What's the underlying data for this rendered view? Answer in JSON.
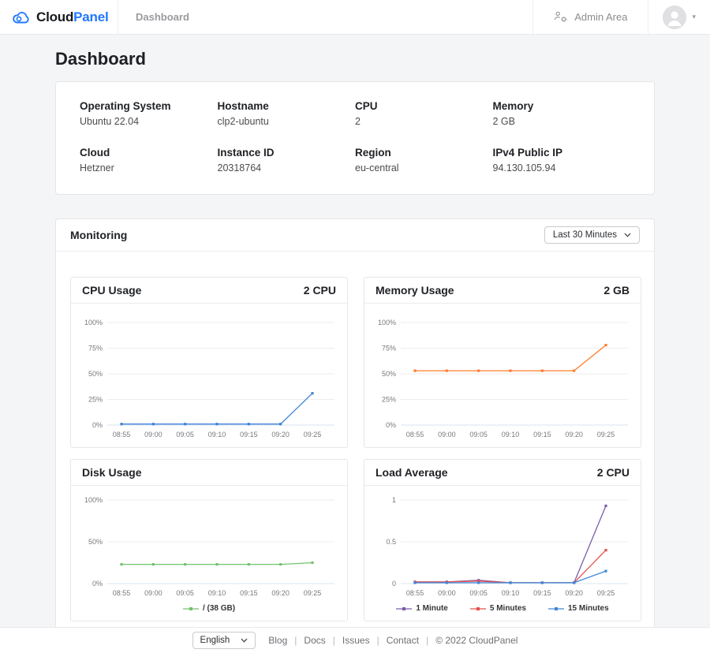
{
  "navbar": {
    "brand_primary": "Cloud",
    "brand_secondary": "Panel",
    "breadcrumb": "Dashboard",
    "admin_area_label": "Admin Area"
  },
  "page": {
    "title": "Dashboard"
  },
  "system_info": {
    "fields": [
      {
        "label": "Operating System",
        "value": "Ubuntu 22.04"
      },
      {
        "label": "Hostname",
        "value": "clp2-ubuntu"
      },
      {
        "label": "CPU",
        "value": "2"
      },
      {
        "label": "Memory",
        "value": "2 GB"
      },
      {
        "label": "Cloud",
        "value": "Hetzner"
      },
      {
        "label": "Instance ID",
        "value": "20318764"
      },
      {
        "label": "Region",
        "value": "eu-central"
      },
      {
        "label": "IPv4 Public IP",
        "value": "94.130.105.94"
      }
    ]
  },
  "monitoring": {
    "title": "Monitoring",
    "range_selected": "Last 30 Minutes"
  },
  "chart_data": [
    {
      "type": "line",
      "title": "CPU Usage",
      "annotation": "2 CPU",
      "x": [
        "08:55",
        "09:00",
        "09:05",
        "09:10",
        "09:15",
        "09:20",
        "09:25"
      ],
      "ylim": [
        0,
        100
      ],
      "yticks": [
        {
          "v": 0,
          "label": "0%"
        },
        {
          "v": 25,
          "label": "25%"
        },
        {
          "v": 50,
          "label": "50%"
        },
        {
          "v": 75,
          "label": "75%"
        },
        {
          "v": 100,
          "label": "100%"
        }
      ],
      "show_legend": false,
      "series": [
        {
          "name": "CPU Usage",
          "color": "#3f83d8",
          "values": [
            1,
            1,
            1,
            1,
            1,
            1,
            31
          ]
        }
      ]
    },
    {
      "type": "line",
      "title": "Memory Usage",
      "annotation": "2 GB",
      "x": [
        "08:55",
        "09:00",
        "09:05",
        "09:10",
        "09:15",
        "09:20",
        "09:25"
      ],
      "ylim": [
        0,
        100
      ],
      "yticks": [
        {
          "v": 0,
          "label": "0%"
        },
        {
          "v": 25,
          "label": "25%"
        },
        {
          "v": 50,
          "label": "50%"
        },
        {
          "v": 75,
          "label": "75%"
        },
        {
          "v": 100,
          "label": "100%"
        }
      ],
      "show_legend": false,
      "series": [
        {
          "name": "Memory Usage",
          "color": "#ff7d2a",
          "values": [
            53,
            53,
            53,
            53,
            53,
            53,
            78
          ]
        }
      ]
    },
    {
      "type": "line",
      "title": "Disk Usage",
      "annotation": "",
      "x": [
        "08:55",
        "09:00",
        "09:05",
        "09:10",
        "09:15",
        "09:20",
        "09:25"
      ],
      "ylim": [
        0,
        100
      ],
      "yticks": [
        {
          "v": 0,
          "label": "0%"
        },
        {
          "v": 50,
          "label": "50%"
        },
        {
          "v": 100,
          "label": "100%"
        }
      ],
      "show_legend": true,
      "series": [
        {
          "name": "/ (38 GB)",
          "color": "#74c26d",
          "values": [
            23,
            23,
            23,
            23,
            23,
            23,
            25
          ]
        }
      ]
    },
    {
      "type": "line",
      "title": "Load Average",
      "annotation": "2 CPU",
      "x": [
        "08:55",
        "09:00",
        "09:05",
        "09:10",
        "09:15",
        "09:20",
        "09:25"
      ],
      "ylim": [
        0,
        1
      ],
      "yticks": [
        {
          "v": 0,
          "label": "0"
        },
        {
          "v": 0.5,
          "label": "0.5"
        },
        {
          "v": 1,
          "label": "1"
        }
      ],
      "show_legend": true,
      "series": [
        {
          "name": "1 Minute",
          "color": "#7a5ca8",
          "values": [
            0.02,
            0.02,
            0.04,
            0.01,
            0.01,
            0.01,
            0.93
          ]
        },
        {
          "name": "5 Minutes",
          "color": "#e4504e",
          "values": [
            0.02,
            0.02,
            0.03,
            0.01,
            0.01,
            0.01,
            0.4
          ]
        },
        {
          "name": "15 Minutes",
          "color": "#3f87d8",
          "values": [
            0.01,
            0.01,
            0.01,
            0.01,
            0.01,
            0.01,
            0.15
          ]
        }
      ]
    }
  ],
  "footer": {
    "language_selected": "English",
    "links": [
      "Blog",
      "Docs",
      "Issues",
      "Contact"
    ],
    "separator": "|",
    "copyright": "© 2022  CloudPanel"
  }
}
